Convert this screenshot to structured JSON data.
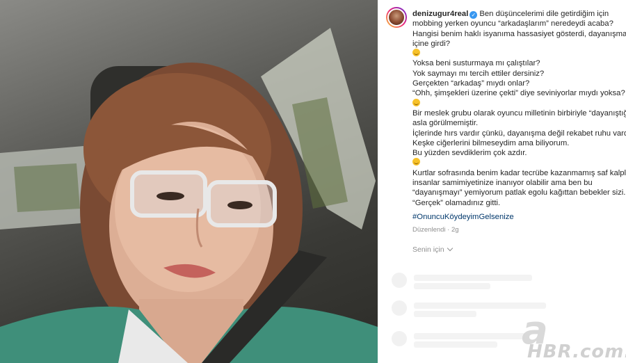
{
  "post": {
    "username": "denizugur4real",
    "caption_lines": [
      "Ben düşüncelerimi dile getirdiğim için",
      "mobbing yerken oyuncu “arkadaşlarım” neredeydi acaba?",
      "Hangisi benim haklı isyanıma hassasiyet gösterdi, dayanışma",
      "içine girdi?",
      "",
      "Yoksa beni susturmaya mı çalıştılar?",
      "Yok saymayı mı tercih ettiler dersiniz?",
      "Gerçekten “arkadaş” mıydı onlar?",
      "“Ohh, şimşekleri üzerine çekti” diye seviniyorlar mıydı yoksa?",
      "",
      "Bir meslek grubu olarak oyuncu milletinin birbiriyle “dayanıştığı”",
      "asla görülmemiştir.",
      "İçlerinde hırs vardır çünkü, dayanışma değil rekabet ruhu vardır.",
      "Keşke ciğerlerini bilmeseydim ama biliyorum.",
      "Bu yüzden sevdiklerim çok azdır.",
      "",
      "Kurtlar sofrasında benim kadar tecrübe kazanmamış saf kalpli",
      "insanlar samimiyetinize inanıyor olabilir ama ben bu",
      "“dayanışmayı” yemiyorum patlak egolu kağıttan bebekler sizi...",
      "“Gerçek” olamadınız gitti."
    ],
    "hashtag": "#OnuncuKöydeyimGelsenize",
    "edited_label": "Düzenlendi",
    "time": "2g",
    "for_you_label": "Senin için"
  },
  "watermark": {
    "letter": "a",
    "text": "HBR.com.tr"
  },
  "colors": {
    "link": "#00376b",
    "verified": "#3897f0",
    "muted": "#8e8e8e"
  }
}
